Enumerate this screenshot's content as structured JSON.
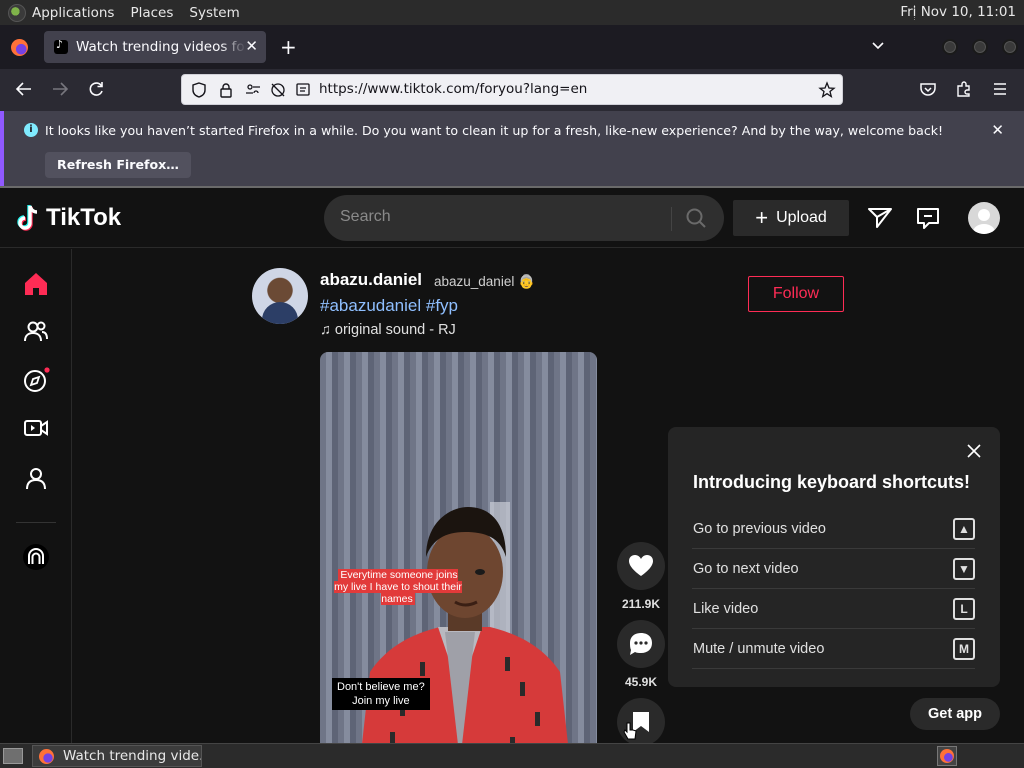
{
  "system_panel": {
    "menus": [
      "Applications",
      "Places",
      "System"
    ],
    "clock": "Fri Nov 10, 11:01"
  },
  "browser": {
    "tab_title": "Watch trending videos for you",
    "url": "https://www.tiktok.com/foryou?lang=en",
    "notification": {
      "message": "It looks like you haven’t started Firefox in a while. Do you want to clean it up for a fresh, like-new experience? And by the way, welcome back!",
      "button_label": "Refresh Firefox…"
    }
  },
  "tiktok": {
    "logo_text": "TikTok",
    "search_placeholder": "Search",
    "upload_label": "Upload",
    "post": {
      "username": "abazu.daniel",
      "nickname": "abazu_daniel 👵",
      "hashtags": "#abazudaniel #fyp",
      "sound": "original sound - RJ",
      "follow_label": "Follow",
      "caption_top": "Everytime someone joins my live I have to shout their names",
      "caption_bottom_line1": "Don't believe me?",
      "caption_bottom_line2": "Join my live",
      "likes": "211.9K",
      "comments": "45.9K"
    },
    "shortcuts_panel": {
      "title": "Introducing keyboard shortcuts!",
      "items": [
        {
          "label": "Go to previous video",
          "key": "▲"
        },
        {
          "label": "Go to next video",
          "key": "▼"
        },
        {
          "label": "Like video",
          "key": "L"
        },
        {
          "label": "Mute / unmute video",
          "key": "M"
        }
      ]
    },
    "get_app_label": "Get app",
    "accent_color": "#fe2c55"
  },
  "taskbar": {
    "task_label": "Watch trending vide..."
  }
}
